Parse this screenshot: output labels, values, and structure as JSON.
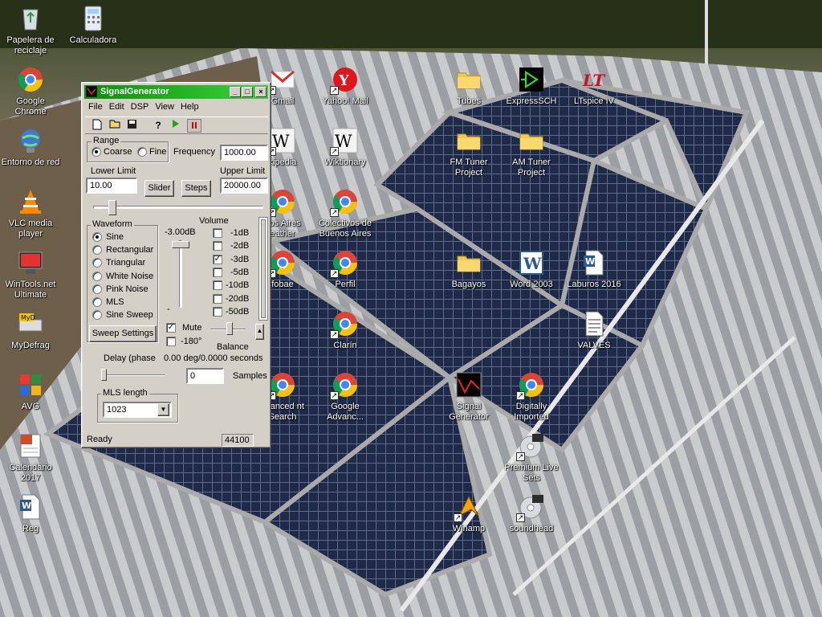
{
  "desktop_icons": [
    {
      "id": "recycle",
      "label": "Papelera de reciclaje",
      "icon": "recycle-bin-icon",
      "shortcut": false
    },
    {
      "id": "calc",
      "label": "Calculadora",
      "icon": "calculator-icon",
      "shortcut": false
    },
    {
      "id": "chrome",
      "label": "Google Chrome",
      "icon": "chrome-icon",
      "shortcut": false
    },
    {
      "id": "network",
      "label": "Entorno de red",
      "icon": "network-icon",
      "shortcut": false
    },
    {
      "id": "vlc",
      "label": "VLC media player",
      "icon": "vlc-icon",
      "shortcut": false
    },
    {
      "id": "wintools",
      "label": "WinTools.net Ultimate",
      "icon": "wintools-icon",
      "shortcut": false
    },
    {
      "id": "mydefrag",
      "label": "MyDefrag",
      "icon": "mydefrag-icon",
      "shortcut": false
    },
    {
      "id": "avg",
      "label": "AVG",
      "icon": "avg-icon",
      "shortcut": false
    },
    {
      "id": "calendario",
      "label": "Calendario 2017",
      "icon": "calendar-icon",
      "shortcut": false
    },
    {
      "id": "reg",
      "label": "Reg",
      "icon": "word-doc-icon",
      "shortcut": false
    },
    {
      "id": "gmail",
      "label": "Gmail",
      "icon": "gmail-icon",
      "shortcut": true
    },
    {
      "id": "yahoo",
      "label": "Yahoo! Mail",
      "icon": "yahoo-icon",
      "shortcut": true
    },
    {
      "id": "tubes",
      "label": "Tubes",
      "icon": "folder-icon",
      "shortcut": false
    },
    {
      "id": "expresssch",
      "label": "ExpressSCH",
      "icon": "expresssch-icon",
      "shortcut": false
    },
    {
      "id": "ltspice",
      "label": "LTspice IV",
      "icon": "ltspice-icon",
      "shortcut": false
    },
    {
      "id": "wikipedia",
      "label": "kipedia",
      "icon": "wikipedia-icon",
      "shortcut": true
    },
    {
      "id": "wiktionary",
      "label": "Wiktionary",
      "icon": "wikipedia-icon",
      "shortcut": true
    },
    {
      "id": "fmtuner",
      "label": "FM Tuner Project",
      "icon": "folder-icon",
      "shortcut": false
    },
    {
      "id": "amtuner",
      "label": "AM Tuner Project",
      "icon": "folder-icon",
      "shortcut": false
    },
    {
      "id": "baweather",
      "label": "nos Aires eather",
      "icon": "chrome-icon",
      "shortcut": true
    },
    {
      "id": "colectivos",
      "label": "Colectivos de Buenos Aires",
      "icon": "chrome-icon",
      "shortcut": true
    },
    {
      "id": "infobae",
      "label": "fobae",
      "icon": "chrome-icon",
      "shortcut": true
    },
    {
      "id": "perfil",
      "label": "Perfil",
      "icon": "chrome-icon",
      "shortcut": true
    },
    {
      "id": "bagayos",
      "label": "Bagayos",
      "icon": "folder-icon",
      "shortcut": false
    },
    {
      "id": "word2003",
      "label": "Word 2003",
      "icon": "word-icon",
      "shortcut": false
    },
    {
      "id": "laburos",
      "label": "Laburos 2016",
      "icon": "word-doc-icon",
      "shortcut": false
    },
    {
      "id": "clarin",
      "label": "Clarín",
      "icon": "chrome-icon",
      "shortcut": true
    },
    {
      "id": "valves",
      "label": "VALVES",
      "icon": "text-doc-icon",
      "shortcut": false
    },
    {
      "id": "advsearch",
      "label": "dvanced nt Search",
      "icon": "chrome-icon",
      "shortcut": true
    },
    {
      "id": "googleadv",
      "label": "Google Advanc...",
      "icon": "chrome-icon",
      "shortcut": true
    },
    {
      "id": "siggen",
      "label": "Signal Generator",
      "icon": "signal-generator-icon",
      "shortcut": false
    },
    {
      "id": "digitally",
      "label": "Digitally Imported",
      "icon": "chrome-icon",
      "shortcut": true
    },
    {
      "id": "premium",
      "label": "Premium Live Sets",
      "icon": "cd-icon",
      "shortcut": true
    },
    {
      "id": "winamp",
      "label": "Winamp",
      "icon": "winamp-icon",
      "shortcut": true
    },
    {
      "id": "soundhead",
      "label": "soundhead",
      "icon": "cd-icon",
      "shortcut": true
    }
  ],
  "window": {
    "title": "SignalGenerator",
    "title_buttons": {
      "minimize": "_",
      "maximize": "□",
      "close": "×"
    },
    "menu": [
      "File",
      "Edit",
      "DSP",
      "View",
      "Help"
    ],
    "toolbar": {
      "new": "new-file-icon",
      "open": "open-folder-icon",
      "save": "save-icon",
      "help": "?",
      "play": "play-icon",
      "stop": "pause-icon"
    },
    "range": {
      "legend": "Range",
      "coarse": "Coarse",
      "fine": "Fine",
      "selected": "coarse"
    },
    "frequency": {
      "label": "Frequency",
      "value": "1000.00"
    },
    "lower_limit": {
      "label": "Lower Limit",
      "value": "10.00"
    },
    "upper_limit": {
      "label": "Upper Limit",
      "value": "20000.00"
    },
    "slider_button": "Slider",
    "steps_button": "Steps",
    "waveform": {
      "legend": "Waveform",
      "options": [
        "Sine",
        "Rectangular",
        "Triangular",
        "White Noise",
        "Pink Noise",
        "MLS",
        "Sine Sweep"
      ],
      "selected": "Sine"
    },
    "sweep_settings": "Sweep Settings",
    "volume": {
      "label": "Volume",
      "readout": "-3.00dB",
      "steps": [
        "-1dB",
        "-2dB",
        "-3dB",
        "-5dB",
        "-10dB",
        "-20dB",
        "-50dB"
      ],
      "checked": "-3dB",
      "minus": "-"
    },
    "mute": {
      "label": "Mute",
      "checked": true
    },
    "invert": {
      "label": "-180°",
      "checked": false
    },
    "balance": "Balance",
    "delay": {
      "label": "Delay (phase",
      "readout": "0.00 deg/0.0000 seconds",
      "samples_value": "0",
      "samples_label": "Samples"
    },
    "mls_length": {
      "legend": "MLS length",
      "value": "1023"
    },
    "status": {
      "text": "Ready",
      "rate": "44100"
    }
  },
  "colors": {
    "titlebar_start": "#0a8f0a",
    "titlebar_end": "#3cd23c",
    "window_face": "#d4d0c8"
  }
}
